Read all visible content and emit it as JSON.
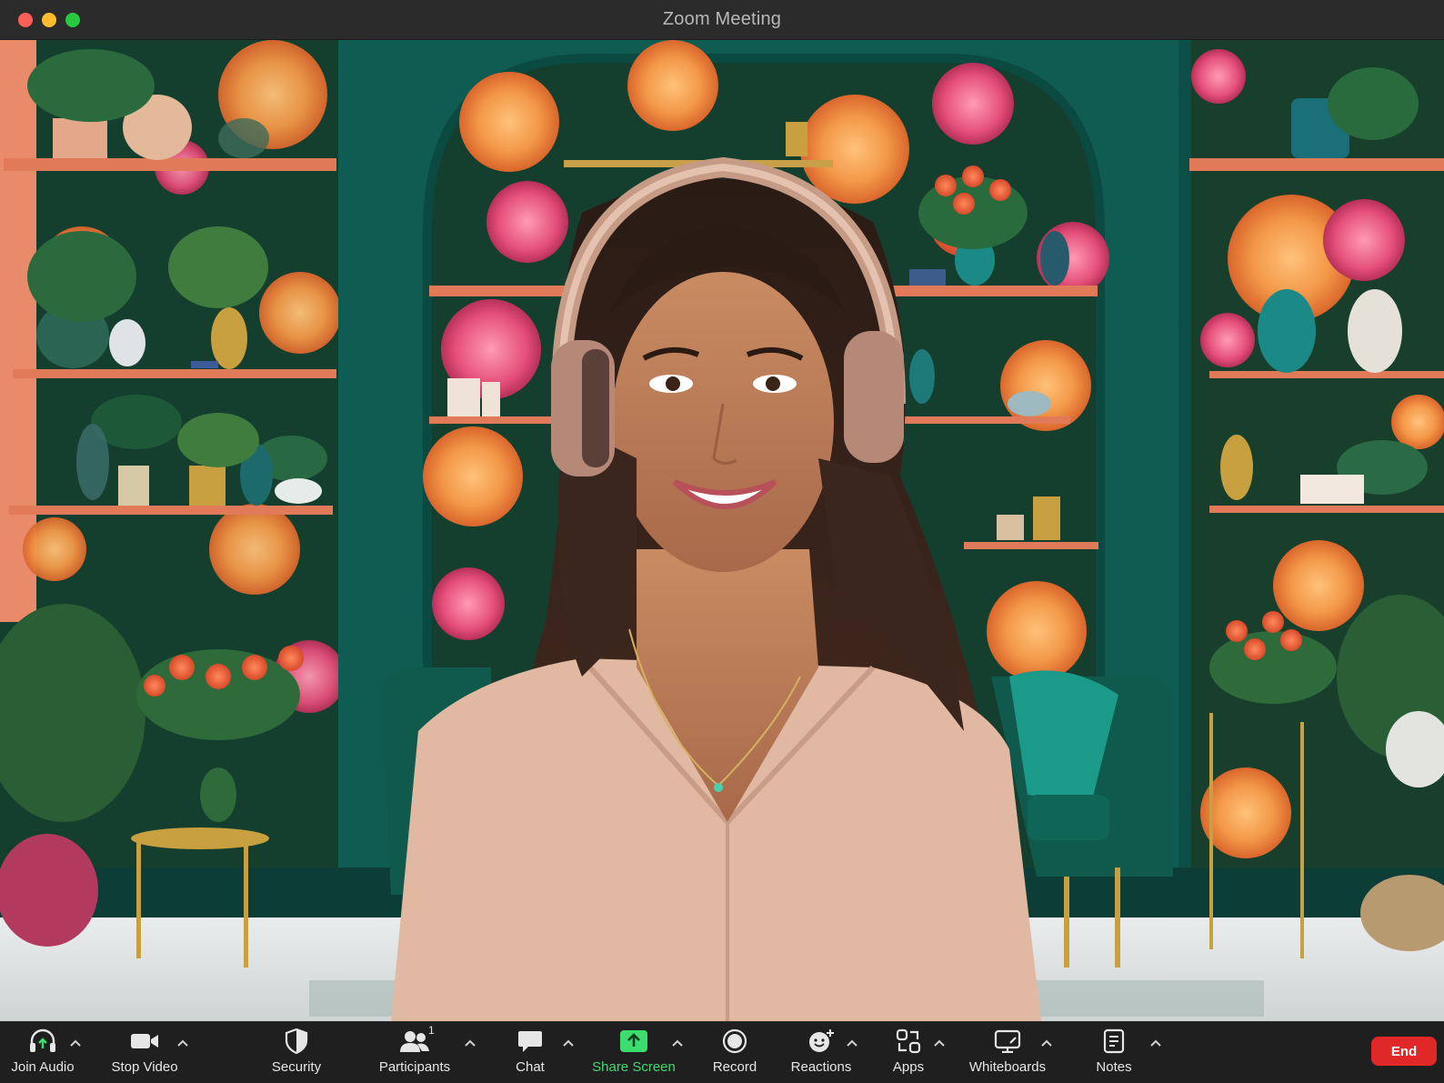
{
  "window": {
    "title": "Zoom Meeting"
  },
  "toolbar": {
    "join_audio": "Join Audio",
    "stop_video": "Stop Video",
    "security": "Security",
    "participants": "Participants",
    "participants_count": "1",
    "chat": "Chat",
    "share_screen": "Share Screen",
    "record": "Record",
    "reactions": "Reactions",
    "apps": "Apps",
    "whiteboards": "Whiteboards",
    "notes": "Notes",
    "end": "End"
  },
  "colors": {
    "share_accent": "#3ddc6e",
    "end_button": "#e02828",
    "toolbar_bg": "#1f1f1f"
  },
  "icons": {
    "join_audio": "headphones-icon",
    "stop_video": "video-camera-icon",
    "security": "shield-icon",
    "participants": "people-icon",
    "chat": "chat-bubble-icon",
    "share_screen": "share-arrow-icon",
    "record": "record-icon",
    "reactions": "smiley-plus-icon",
    "apps": "apps-icon",
    "whiteboards": "whiteboard-icon",
    "notes": "notes-icon"
  }
}
